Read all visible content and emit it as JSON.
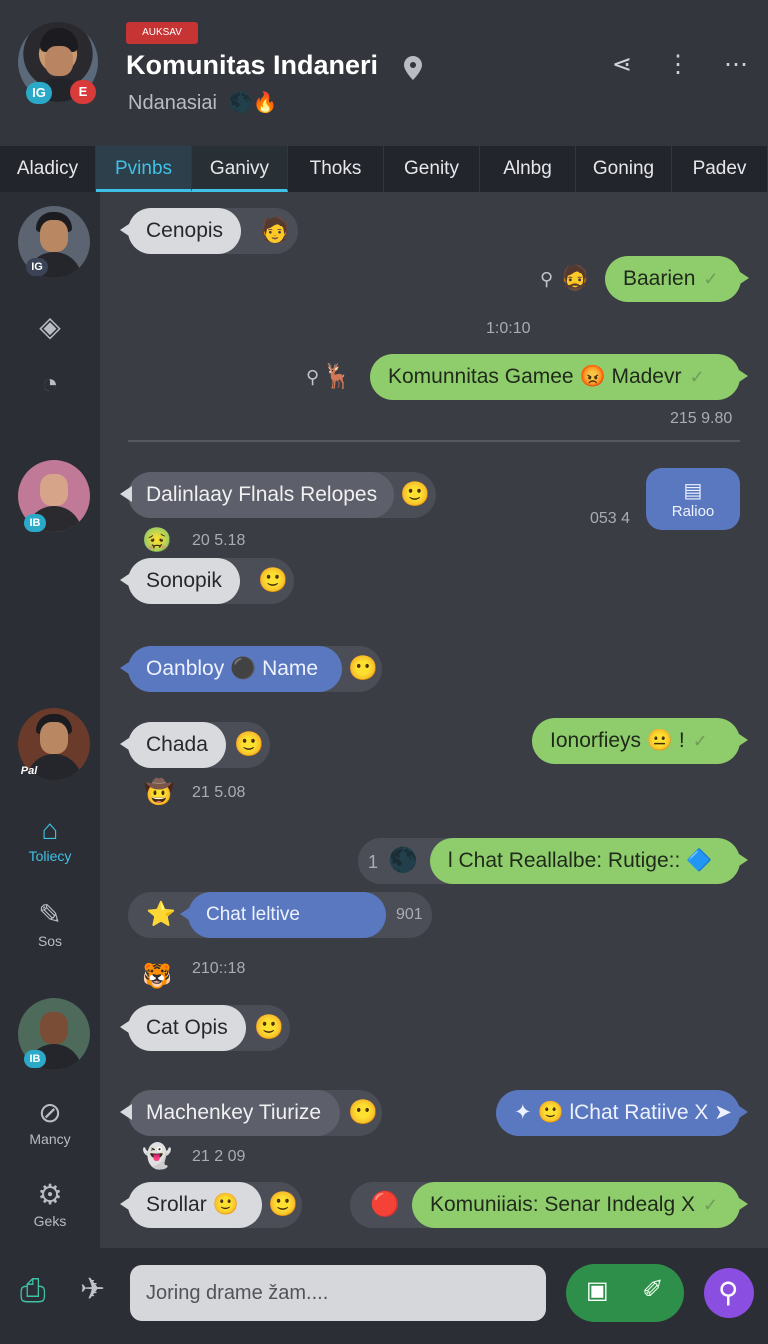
{
  "header": {
    "tag": "AUKSAV",
    "title": "Komunitas Indaneri",
    "subtitle": "Ndanasiai",
    "badges": [
      "IG",
      "E"
    ]
  },
  "tabs": [
    {
      "label": "Aladicy"
    },
    {
      "label": "Pvinbs"
    },
    {
      "label": "Ganivy"
    },
    {
      "label": "Thoks"
    },
    {
      "label": "Genity"
    },
    {
      "label": "Alnbg"
    },
    {
      "label": "Goning"
    },
    {
      "label": "Padev"
    }
  ],
  "sidebar": {
    "badge1": "IG",
    "badge2": "IB",
    "avatar3_label": "Pal",
    "badge4": "IB",
    "home_label": "Toliecy",
    "edit_label": "Sos",
    "compass_label": "Mancy",
    "gear_label": "Geks"
  },
  "messages": {
    "m1": "Cenopis",
    "m2": "Baarien",
    "ts1": "1:0:10",
    "m3": "Komunnitas Gamee",
    "m3b": "Madevr",
    "ts2": "215 9.80",
    "m4": "Dalinlaay Flnals Relopes",
    "ts3": "20 5.18",
    "card_ts": "053 4",
    "card_label": "Ralioo",
    "m5": "Sonopik",
    "m6a": "Oanbloy",
    "m6b": "Name",
    "m7": "Chada",
    "m8": "Ionorfieys",
    "ts4": "21 5.08",
    "m9_count": "1",
    "m9": "l Chat Reallalbe: Rutige::",
    "m10": "Chat leltive",
    "m10_ts": "901",
    "ts5": "210::18",
    "m11": "Cat Opis",
    "m12": "Machenkey Tiurize",
    "m13": "lChat Ratiive X",
    "ts6": "21 2 09",
    "m14": "Srollar",
    "m15": "Komuniiais: Senar Indealg X"
  },
  "composer": {
    "placeholder": "Joring drame žam...."
  },
  "colors": {
    "accent": "#3fc1e6",
    "outgoing": "#8fcd6c",
    "blue": "#5a78c0",
    "send": "#2e8f4a",
    "purple": "#8a4ee0"
  }
}
